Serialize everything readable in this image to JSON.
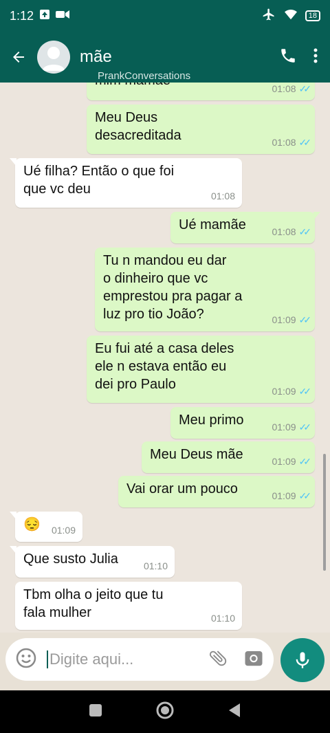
{
  "status": {
    "time": "1:12",
    "battery": "18"
  },
  "header": {
    "contact_name": "mãe",
    "watermark": "PrankConversations"
  },
  "messages": [
    {
      "dir": "out",
      "text": "mim mamãe",
      "time": "01:08"
    },
    {
      "dir": "out",
      "text": "Meu Deus\ndesacreditada",
      "time": "01:08"
    },
    {
      "dir": "in",
      "text": "Ué filha? Então o que foi\nque vc deu",
      "time": "01:08"
    },
    {
      "dir": "out",
      "text": "Ué mamãe",
      "time": "01:08"
    },
    {
      "dir": "out",
      "text": "Tu n mandou eu dar\no dinheiro que vc\nemprestou pra pagar a\nluz pro tio João?",
      "time": "01:09"
    },
    {
      "dir": "out",
      "text": "Eu fui até a casa deles\nele n estava então eu\ndei pro Paulo",
      "time": "01:09"
    },
    {
      "dir": "out",
      "text": "Meu primo",
      "time": "01:09"
    },
    {
      "dir": "out",
      "text": "Meu Deus mãe",
      "time": "01:09"
    },
    {
      "dir": "out",
      "text": "Vai orar um pouco",
      "time": "01:09"
    },
    {
      "dir": "in",
      "text": "😔",
      "time": "01:09"
    },
    {
      "dir": "in",
      "text": "Que susto Julia",
      "time": "01:10"
    },
    {
      "dir": "in",
      "text": "Tbm olha o jeito que tu\nfala mulher",
      "time": "01:10"
    }
  ],
  "composer": {
    "placeholder": "Digite aqui..."
  },
  "colors": {
    "header": "#075e54",
    "outgoing": "#dcf8c6",
    "incoming": "#ffffff",
    "mic": "#128c7e",
    "ticks": "#4fc3f7"
  }
}
